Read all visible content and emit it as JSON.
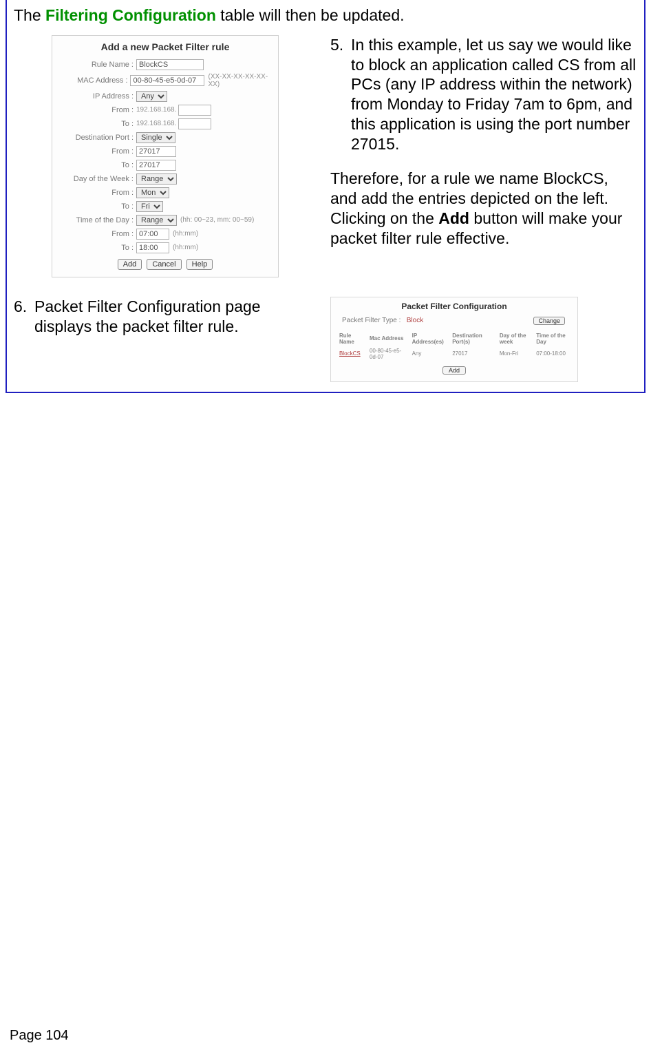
{
  "intro": {
    "pre": "The ",
    "green": "Filtering Configuration",
    "post": " table will then be updated."
  },
  "dialog": {
    "title": "Add a new Packet Filter rule",
    "labels": {
      "ruleName": "Rule Name :",
      "mac": "MAC Address :",
      "ip": "IP Address :",
      "from": "From :",
      "to": "To :",
      "destPort": "Destination Port :",
      "dayOfWeek": "Day of the Week :",
      "timeOfDay": "Time of the Day :"
    },
    "values": {
      "ruleName": "BlockCS",
      "mac": "00-80-45-e5-0d-07",
      "macHint": "(XX-XX-XX-XX-XX-XX)",
      "ipSel": "Any",
      "ipFromPrefix": "192.168.168.",
      "ipToPrefix": "192.168.168.",
      "destPortSel": "Single",
      "portFrom": "27017",
      "portTo": "27017",
      "dowSel": "Range",
      "dowFrom": "Mon",
      "dowTo": "Fri",
      "todSel": "Range",
      "todHint": "(hh: 00~23, mm: 00~59)",
      "todFrom": "07:00",
      "todFromHint": "(hh:mm)",
      "todTo": "18:00",
      "todToHint": "(hh:mm)"
    },
    "buttons": {
      "add": "Add",
      "cancel": "Cancel",
      "help": "Help"
    }
  },
  "step5": {
    "num": "5.",
    "para1": "In this example, let us say we would like to block an application called CS from all PCs (any IP address within the network) from Monday to Friday 7am to 6pm, and this application is using the port number 27015.",
    "para2_pre": "Therefore, for a rule we name BlockCS, and add the entries depicted on the left. Clicking on the ",
    "para2_bold": "Add",
    "para2_post": " button will make your packet filter rule effective."
  },
  "step6": {
    "num": "6.",
    "text": "Packet Filter Configuration page displays the packet filter rule."
  },
  "configPanel": {
    "title": "Packet Filter Configuration",
    "typeLabel": "Packet Filter Type :",
    "typeValue": "Block",
    "changeBtn": "Change",
    "headers": [
      "Rule Name",
      "Mac Address",
      "IP Address(es)",
      "Destination Port(s)",
      "Day of the week",
      "Time of the Day"
    ],
    "row": [
      "BlockCS",
      "00-80-45-e5-0d-07",
      "Any",
      "27017",
      "Mon-Fri",
      "07:00-18:00"
    ],
    "addBtn": "Add"
  },
  "pageNum": "Page 104"
}
